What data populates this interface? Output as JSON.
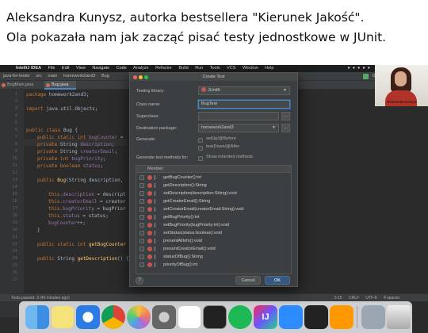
{
  "caption": {
    "line1": "Aleksandra Kunysz, autorka bestsellera \"Kierunek Jakość\".",
    "line2": "Ola pokazała nam jak zacząć pisać testy jednostkowe w JUnit."
  },
  "menubar": {
    "apple": "",
    "app": "IntelliJ IDEA",
    "items": [
      "File",
      "Edit",
      "View",
      "Navigate",
      "Code",
      "Analyze",
      "Refactor",
      "Build",
      "Run",
      "Tools",
      "VCS",
      "Window",
      "Help"
    ]
  },
  "navbar": {
    "crumbs": [
      "java-for-tester",
      "src",
      "main",
      "homework2and3",
      "Bug"
    ],
    "git_label": "Git:"
  },
  "tabs": [
    "BugMain.java",
    "Bug.java"
  ],
  "gutter_lines": [
    "1",
    "2",
    "3",
    "4",
    "5",
    "6",
    "7",
    "8",
    "9",
    "10",
    "11",
    "12",
    "13",
    "14",
    "15",
    "16",
    "17",
    "18",
    "19",
    "20",
    "21",
    "22",
    "23",
    "24",
    "25",
    "26",
    "27"
  ],
  "code": {
    "l1_kw": "package",
    "l1_rest": " homework2and3;",
    "l3_kw": "import",
    "l3_rest": " java.util.Objects;",
    "l6_kw": "public class",
    "l6_name": " Bug",
    "l6_rest": " {",
    "l7_kw": "public static int",
    "l7_fld": " bugCounter",
    "l7_rest": " =",
    "l8_kw": "private",
    "l8_ty": " String",
    "l8_fld": " description",
    "l9_kw": "private",
    "l9_ty": " String",
    "l9_fld": " creatorEmail",
    "l10_kw": "private int",
    "l10_fld": " bugPriority",
    "l11_kw": "private boolean",
    "l11_fld": " status",
    "l13_kw": "public",
    "l13_fn": " Bug",
    "l13_rest": "(String description,",
    "l15_kw": "this",
    "l15_fld": ".description",
    "l15_rest": " = descript",
    "l16_kw": "this",
    "l16_fld": ".creatorEmail",
    "l16_rest": " = creator",
    "l17_kw": "this",
    "l17_fld": ".bugPriority",
    "l17_rest": " = bugPrior",
    "l18_kw": "this",
    "l18_fld": ".status",
    "l18_rest": " = status;",
    "l19_fld": "bugCounter",
    "l19_rest": "++;",
    "l20_rest": "}",
    "l22_kw": "public static int",
    "l22_fn": " getBugCounter",
    "l24_kw": "public",
    "l24_ty": " String",
    "l24_fn": " getDescription",
    "l24_rest": "() {"
  },
  "dialog": {
    "title": "Create Test",
    "testing_library_label": "Testing library:",
    "testing_library_value": "JUnit5",
    "class_name_label": "Class name:",
    "class_name_value": "BugTest",
    "superclass_label": "Superclass:",
    "superclass_value": "",
    "destination_label": "Destination package:",
    "destination_value": "homework2and3",
    "generate_label": "Generate:",
    "setup_label": "setUp/@Before",
    "teardown_label": "tearDown/@After",
    "methods_label": "Generate test methods for:",
    "show_inherited_label": "Show inherited methods",
    "member_header": "Member",
    "methods": [
      "getBugCounter():int",
      "getDescription():String",
      "setDescription(description:String):void",
      "getCreatorEmail():String",
      "setCreatorEmail(creatorEmail:String):void",
      "getBugPriority():int",
      "setBugPriority(bugPriority:int):void",
      "setStatus(status:boolean):void",
      "presentAllInfo():void",
      "presentCreatorEmail():void",
      "statusOfBug():String",
      "priorityOfBug():int"
    ],
    "help_label": "?",
    "cancel_label": "Cancel",
    "ok_label": "OK"
  },
  "statusbar": {
    "left": "Tests passed: 3 (46 minutes ago)",
    "position": "5:15",
    "line_sep": "CRLF",
    "encoding": "UTF-8",
    "indent": "4 spaces"
  },
  "webcam": {
    "name": "Aleksandra Kunysz"
  },
  "dock": {
    "icons": [
      "finder-icon",
      "notes-icon",
      "safari-icon",
      "chrome-icon",
      "photos-icon",
      "system-preferences-icon",
      "slack-icon",
      "activity-monitor-icon",
      "spotify-icon",
      "intellij-icon",
      "zoom-icon",
      "terminal-icon",
      "sublime-icon",
      "files-icon",
      "trash-icon"
    ],
    "intellij_label": "IJ"
  }
}
